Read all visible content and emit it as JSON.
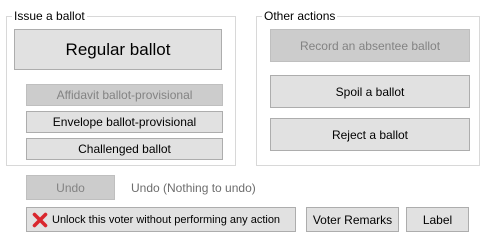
{
  "issue_group": {
    "title": "Issue a ballot",
    "regular_label": "Regular ballot",
    "affidavit_label": "Affidavit ballot-provisional",
    "envelope_label": "Envelope ballot-provisional",
    "challenged_label": "Challenged ballot"
  },
  "other_group": {
    "title": "Other actions",
    "absentee_label": "Record an absentee ballot",
    "spoil_label": "Spoil a ballot",
    "reject_label": "Reject a ballot"
  },
  "undo": {
    "button_label": "Undo",
    "status_text": "Undo (Nothing to undo)"
  },
  "footer": {
    "unlock_label": "Unlock this voter without performing any action",
    "unlock_icon": "red-x-icon",
    "remarks_label": "Voter Remarks",
    "label_label": "Label"
  },
  "colors": {
    "button_bg": "#e1e1e1",
    "button_disabled_bg": "#cccccc",
    "disabled_text": "#838383",
    "icon_red": "#d9272e"
  }
}
